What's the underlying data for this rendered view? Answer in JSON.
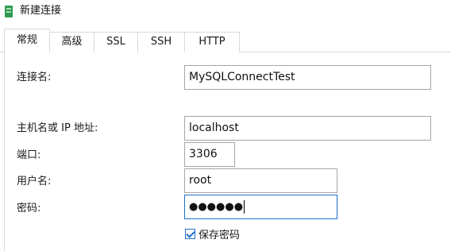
{
  "window": {
    "title": "新建连接",
    "icon": "connection-icon",
    "accent_color": "#1e6fd0"
  },
  "tabs": [
    {
      "label": "常规",
      "active": true
    },
    {
      "label": "高级",
      "active": false
    },
    {
      "label": "SSL",
      "active": false
    },
    {
      "label": "SSH",
      "active": false
    },
    {
      "label": "HTTP",
      "active": false
    }
  ],
  "form": {
    "connection_name_label": "连接名:",
    "connection_name_value": "MySQLConnectTest",
    "host_label": "主机名或 IP 地址:",
    "host_value": "localhost",
    "port_label": "端口:",
    "port_value": "3306",
    "username_label": "用户名:",
    "username_value": "root",
    "password_label": "密码:",
    "password_value": "●●●●●●",
    "save_password_label": "保存密码",
    "save_password_checked": true
  }
}
